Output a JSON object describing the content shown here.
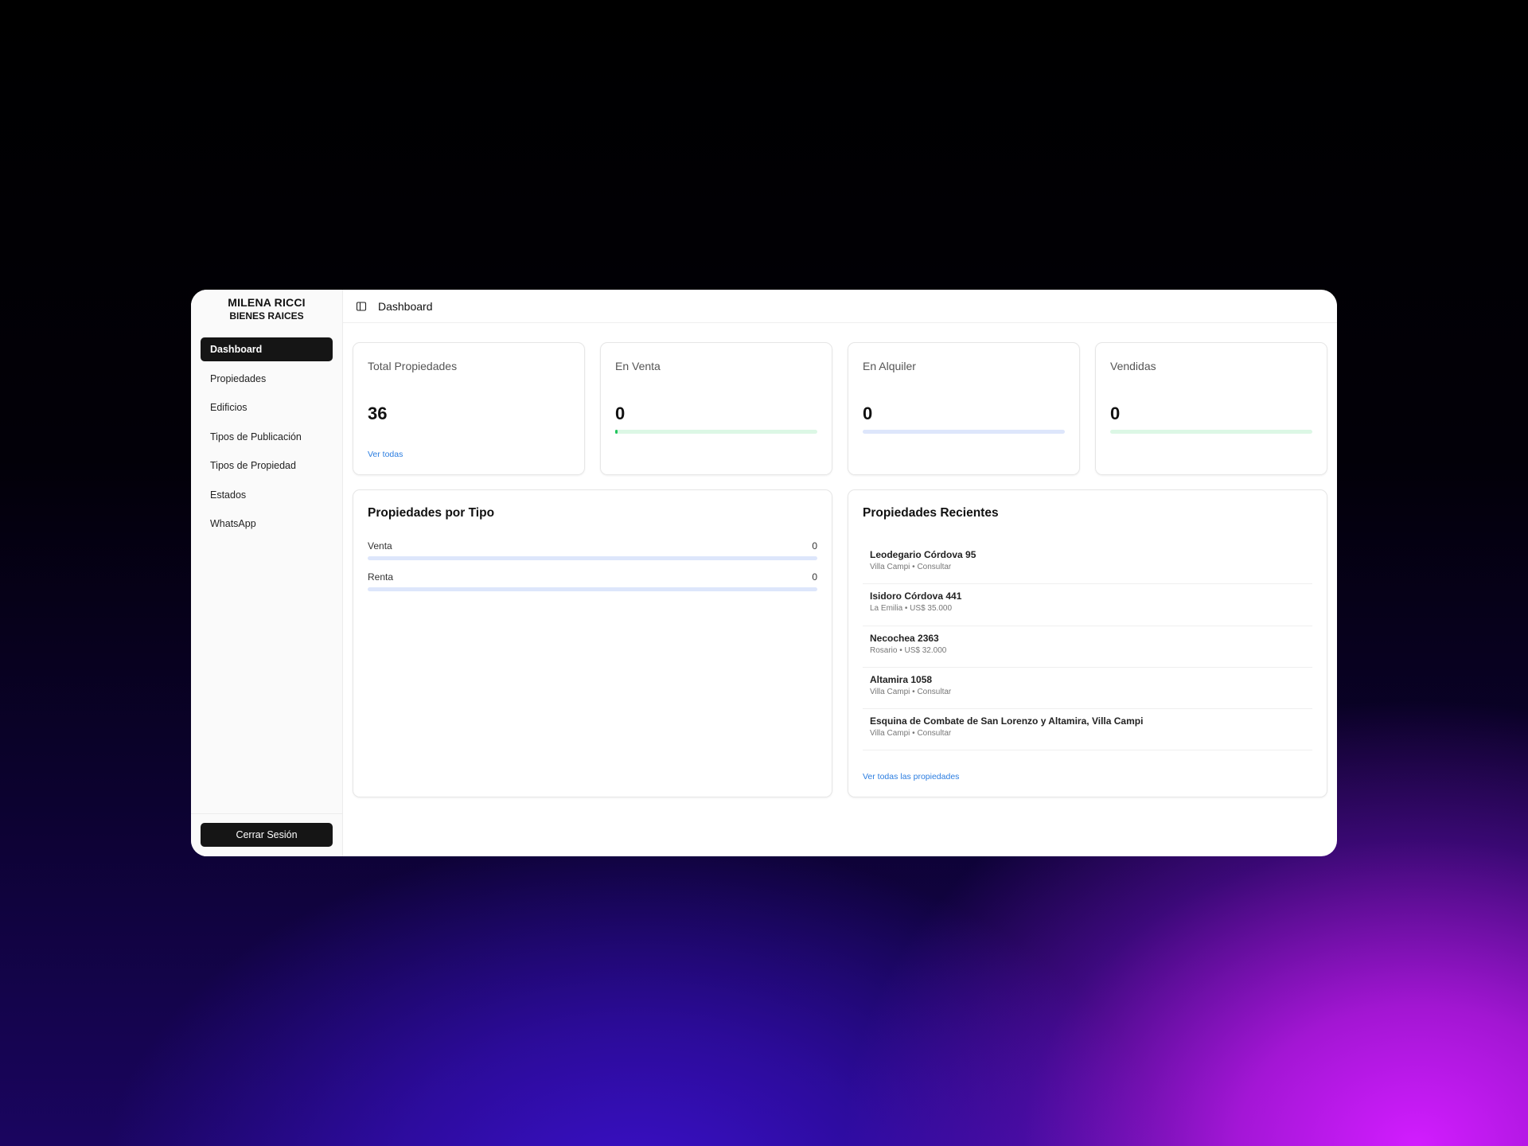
{
  "brand": {
    "line1": "MILENA RICCI",
    "line2": "BIENES RAICES"
  },
  "sidebar": {
    "items": [
      {
        "label": "Dashboard",
        "active": true
      },
      {
        "label": "Propiedades"
      },
      {
        "label": "Edificios"
      },
      {
        "label": "Tipos de Publicación"
      },
      {
        "label": "Tipos de Propiedad"
      },
      {
        "label": "Estados"
      },
      {
        "label": "WhatsApp"
      }
    ],
    "logout_label": "Cerrar Sesión"
  },
  "header": {
    "title": "Dashboard",
    "toggle_icon": "sidebar-toggle-icon"
  },
  "stats": [
    {
      "label": "Total Propiedades",
      "value": "36",
      "link": "Ver todas"
    },
    {
      "label": "En Venta",
      "value": "0",
      "progress": 0.01,
      "bar_color": "#dcf7e5"
    },
    {
      "label": "En Alquiler",
      "value": "0",
      "progress": 0,
      "bar_color": "#dde6fb"
    },
    {
      "label": "Vendidas",
      "value": "0",
      "progress": 0,
      "bar_color": "#dcf7e5"
    }
  ],
  "by_type": {
    "title": "Propiedades por Tipo",
    "rows": [
      {
        "label": "Venta",
        "value": "0",
        "progress": 0
      },
      {
        "label": "Renta",
        "value": "0",
        "progress": 0
      }
    ]
  },
  "recent": {
    "title": "Propiedades Recientes",
    "items": [
      {
        "name": "Leodegario Córdova 95",
        "sub": "Villa Campi • Consultar"
      },
      {
        "name": "Isidoro Córdova 441",
        "sub": "La Emilia • US$ 35.000"
      },
      {
        "name": "Necochea 2363",
        "sub": "Rosario • US$ 32.000"
      },
      {
        "name": "Altamira 1058",
        "sub": "Villa Campi • Consultar"
      },
      {
        "name": "Esquina de Combate de San Lorenzo y Altamira, Villa Campi",
        "sub": "Villa Campi • Consultar"
      }
    ],
    "link": "Ver todas las propiedades"
  },
  "colors": {
    "accent": "#151515",
    "link": "#2b7de0",
    "green_track": "#dcf7e5",
    "blue_track": "#dde6fb"
  }
}
